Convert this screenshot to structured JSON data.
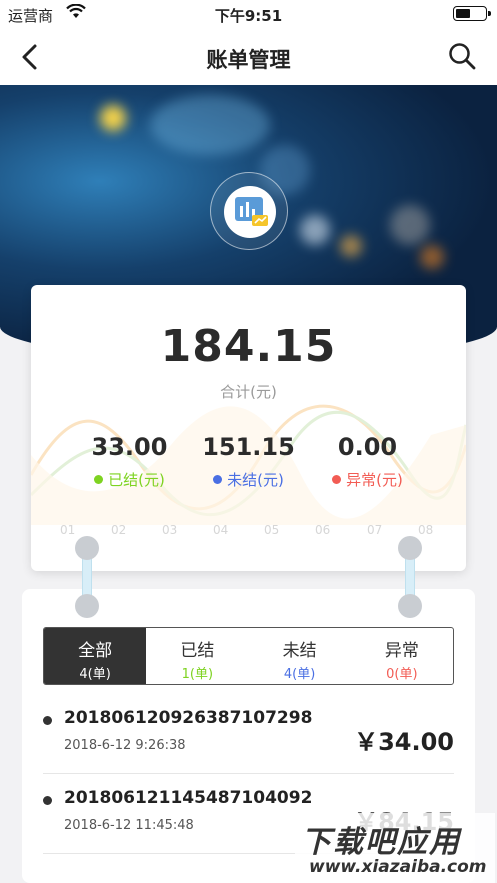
{
  "status_bar": {
    "carrier": "运营商",
    "time": "下午9:51"
  },
  "nav": {
    "title": "账单管理"
  },
  "summary": {
    "total": "184.15",
    "total_label": "合计(元)",
    "stats": [
      {
        "value": "33.00",
        "label": "已结(元)",
        "color": "#7ed321"
      },
      {
        "value": "151.15",
        "label": "未结(元)",
        "color": "#4a6fe3"
      },
      {
        "value": "0.00",
        "label": "异常(元)",
        "color": "#f25c54"
      }
    ],
    "ticks": [
      "01",
      "02",
      "03",
      "04",
      "05",
      "06",
      "07",
      "08"
    ]
  },
  "tabs": [
    {
      "label": "全部",
      "count": "4(单)",
      "count_color": "#ffffff",
      "active": true
    },
    {
      "label": "已结",
      "count": "1(单)",
      "count_color": "#7ed321",
      "active": false
    },
    {
      "label": "未结",
      "count": "4(单)",
      "count_color": "#4a6fe3",
      "active": false
    },
    {
      "label": "异常",
      "count": "0(单)",
      "count_color": "#f25c54",
      "active": false
    }
  ],
  "orders": [
    {
      "id": "201806120926387107298",
      "date": "2018-6-12 9:26:38",
      "amount": "￥34.00"
    },
    {
      "id": "201806121145487104092",
      "date": "2018-6-12 11:45:48",
      "amount": "￥84.15"
    }
  ],
  "watermark": {
    "line1": "下载吧应用",
    "line2": "www.xiazaiba.com"
  }
}
